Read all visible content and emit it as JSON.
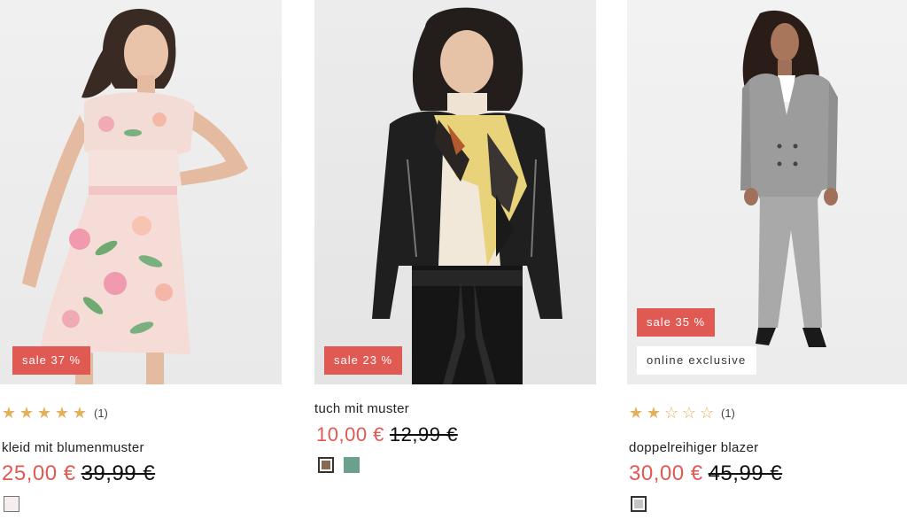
{
  "products": [
    {
      "badges": {
        "sale": "sale 37 %",
        "online": ""
      },
      "rating": {
        "stars_filled": 5,
        "stars_total": 5,
        "count": "(1)",
        "icons": [
          "star-filled-icon",
          "star-outline-icon"
        ]
      },
      "title": "kleid mit blumenmuster",
      "price": {
        "current": "25,00 €",
        "original": "39,99 €"
      },
      "swatches": [
        {
          "color": "#f6eeee",
          "name": "color-swatch-light-rose"
        }
      ]
    },
    {
      "badges": {
        "sale": "sale 23 %",
        "online": ""
      },
      "rating": null,
      "title": "tuch mit muster",
      "price": {
        "current": "10,00 €",
        "original": "12,99 €"
      },
      "swatches": [
        {
          "color": "#8a6a4f",
          "name": "color-swatch-brown",
          "selected": true
        },
        {
          "color": "#6aa08c",
          "name": "color-swatch-green"
        }
      ]
    },
    {
      "badges": {
        "sale": "sale 35 %",
        "online": "online exclusive"
      },
      "rating": {
        "stars_filled": 2,
        "stars_total": 5,
        "count": "(1)",
        "icons": [
          "star-filled-icon",
          "star-outline-icon"
        ]
      },
      "title": "doppelreihiger blazer",
      "price": {
        "current": "30,00 €",
        "original": "45,99 €"
      },
      "swatches": [
        {
          "color": "#c4c4c4",
          "name": "color-swatch-grey"
        }
      ]
    }
  ],
  "colors": {
    "sale_red": "#e05a53",
    "star_gold": "#e3b15b",
    "text": "#222222"
  }
}
